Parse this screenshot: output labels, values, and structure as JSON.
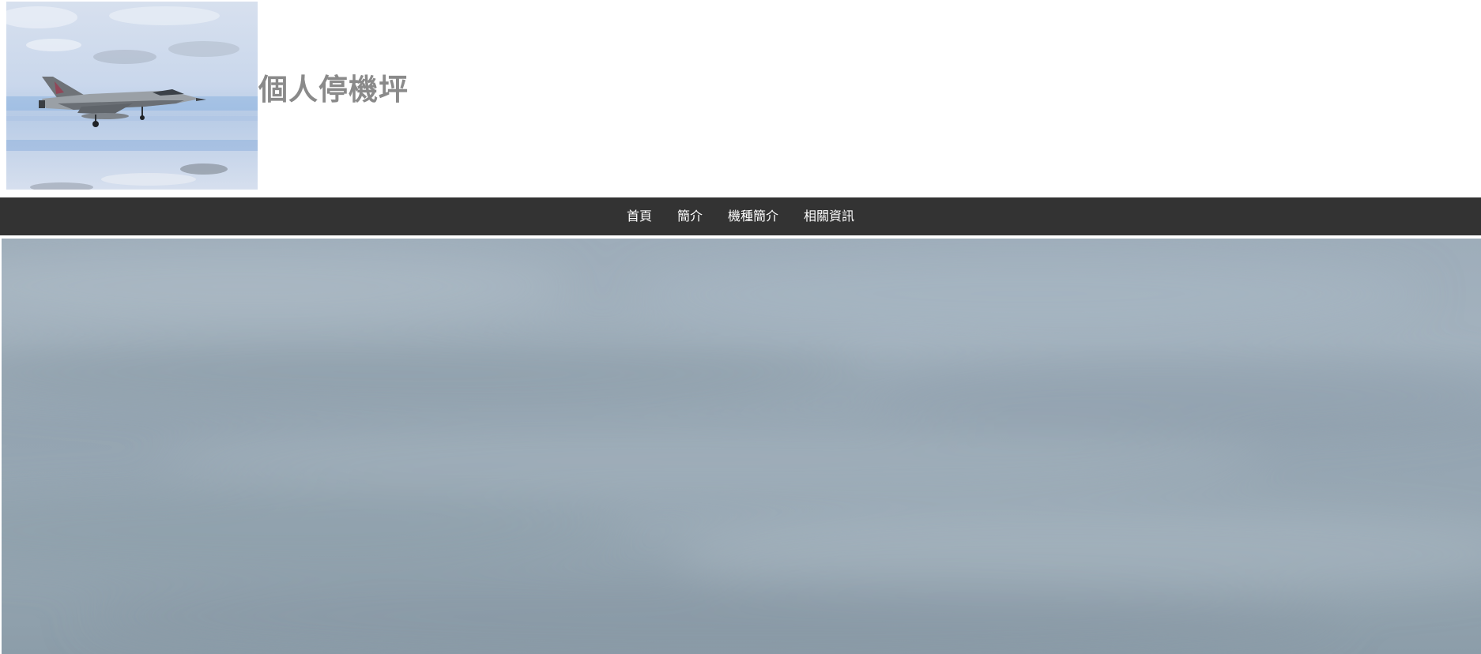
{
  "header": {
    "site_title": "個人停機坪",
    "logo_icon": "fighter-jet-photo-icon"
  },
  "nav": {
    "items": [
      {
        "label": "首頁"
      },
      {
        "label": "簡介"
      },
      {
        "label": "機種簡介"
      },
      {
        "label": "相關資訊"
      }
    ]
  },
  "hero": {
    "image_icon": "cloudy-sky-photo-icon"
  },
  "colors": {
    "navbar_bg": "#333333",
    "nav_text": "#ffffff",
    "title_text": "#8a8a8a",
    "sky": "#9aaab6"
  }
}
